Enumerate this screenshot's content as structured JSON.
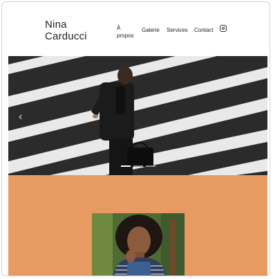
{
  "site": {
    "logo_line1": "Nina",
    "logo_line2": "Carducci"
  },
  "nav": {
    "items": [
      {
        "label": "À propos"
      },
      {
        "label": "Galerie"
      },
      {
        "label": "Services"
      },
      {
        "label": "Contact"
      }
    ],
    "social_icon": "instagram-icon"
  },
  "carousel": {
    "prev_icon": "chevron-left-icon",
    "prev_glyph": "‹",
    "slide_count": 3,
    "active_index": 0
  },
  "colors": {
    "accent_background": "#e89a63",
    "text": "#222222"
  }
}
